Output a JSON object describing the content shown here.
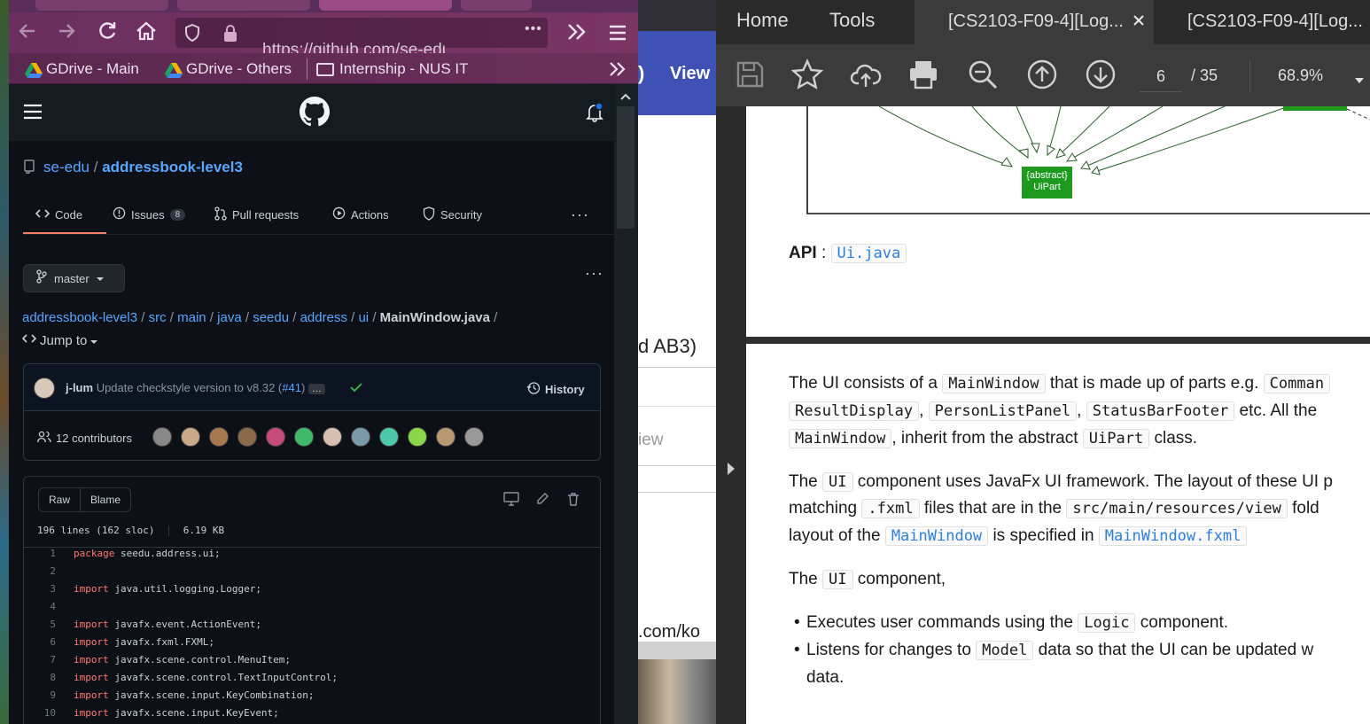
{
  "browser": {
    "url": "https://github.com/se-edu/addr",
    "more_glyph": "•••",
    "bookmarks": [
      "GDrive - Main",
      "GDrive - Others",
      "Internship - NUS IT"
    ]
  },
  "github": {
    "owner": "se-edu",
    "sep": "/",
    "repo": "addressbook-level3",
    "tabs": [
      {
        "label": "Code"
      },
      {
        "label": "Issues",
        "count": "8"
      },
      {
        "label": "Pull requests"
      },
      {
        "label": "Actions"
      },
      {
        "label": "Security"
      }
    ],
    "branch": "master",
    "breadcrumb": [
      "addressbook-level3",
      "src",
      "main",
      "java",
      "seedu",
      "address",
      "ui"
    ],
    "file": "MainWindow.java",
    "jump_to": "Jump to",
    "commit": {
      "author": "j-lum",
      "message": "Update checkstyle version to v8.32 (",
      "pr": "#41",
      "message_end": ")",
      "ellipsis": "…",
      "history": "History"
    },
    "contributors": "12 contributors",
    "raw": "Raw",
    "blame": "Blame",
    "file_info": "196 lines (162 sloc)",
    "file_size": "6.19 KB",
    "code": [
      {
        "n": "1",
        "kw": "package",
        "rest": " seedu.address.ui;"
      },
      {
        "n": "2",
        "kw": "",
        "rest": ""
      },
      {
        "n": "3",
        "kw": "import",
        "rest": " java.util.logging.Logger;"
      },
      {
        "n": "4",
        "kw": "",
        "rest": ""
      },
      {
        "n": "5",
        "kw": "import",
        "rest": " javafx.event.ActionEvent;"
      },
      {
        "n": "6",
        "kw": "import",
        "rest": " javafx.fxml.FXML;"
      },
      {
        "n": "7",
        "kw": "import",
        "rest": " javafx.scene.control.MenuItem;"
      },
      {
        "n": "8",
        "kw": "import",
        "rest": " javafx.scene.control.TextInputControl;"
      },
      {
        "n": "9",
        "kw": "import",
        "rest": " javafx.scene.input.KeyCombination;"
      },
      {
        "n": "10",
        "kw": "import",
        "rest": " javafx.scene.input.KeyEvent;"
      }
    ]
  },
  "middle": {
    "view_label": "View",
    "paren": ")",
    "ab3": "d AB3)",
    "view2": "iew",
    "url": ".com/ko"
  },
  "pdf": {
    "menu": [
      "Home",
      "Tools"
    ],
    "tabs": [
      "[CS2103-F09-4][Log...",
      "[CS2103-F09-4][Log..."
    ],
    "page_current": "6",
    "page_total": "/ 35",
    "zoom": "68.9%",
    "diagram": {
      "line1": "{abstract}",
      "line2": "UiPart"
    },
    "api_label": "API",
    "api_colon": ":",
    "api_file": "Ui.java",
    "p1": {
      "a": "The UI consists of a",
      "mw": "MainWindow",
      "b": "that is made up of parts e.g.",
      "cmd": "Comman",
      "rd": "ResultDisplay",
      "comma": ",",
      "plp": "PersonListPanel",
      "sbf": "StatusBarFooter",
      "c": "etc. All the",
      "mw2": "MainWindow",
      "d": ", inherit from the abstract",
      "uipart": "UiPart",
      "e": "class."
    },
    "p2": {
      "a": "The",
      "ui": "UI",
      "b": "component uses JavaFx UI framework. The layout of these UI p",
      "c": "matching",
      "fxml": ".fxml",
      "d": "files that are in the",
      "path": "src/main/resources/view",
      "e": "fold",
      "f": "layout of the",
      "mw": "MainWindow",
      "g": "is specified in",
      "mwf": "MainWindow.fxml"
    },
    "p3": {
      "a": "The",
      "ui": "UI",
      "b": "component,"
    },
    "bullets": [
      {
        "a": "Executes user commands using the",
        "code": "Logic",
        "b": "component."
      },
      {
        "a": "Listens for changes to",
        "code": "Model",
        "b": "data so that the UI can be updated w"
      }
    ],
    "bullet_cont": "data.",
    "colors": {
      "accent": "#2f7fd8",
      "diagram_green": "#1e9a1e"
    }
  }
}
